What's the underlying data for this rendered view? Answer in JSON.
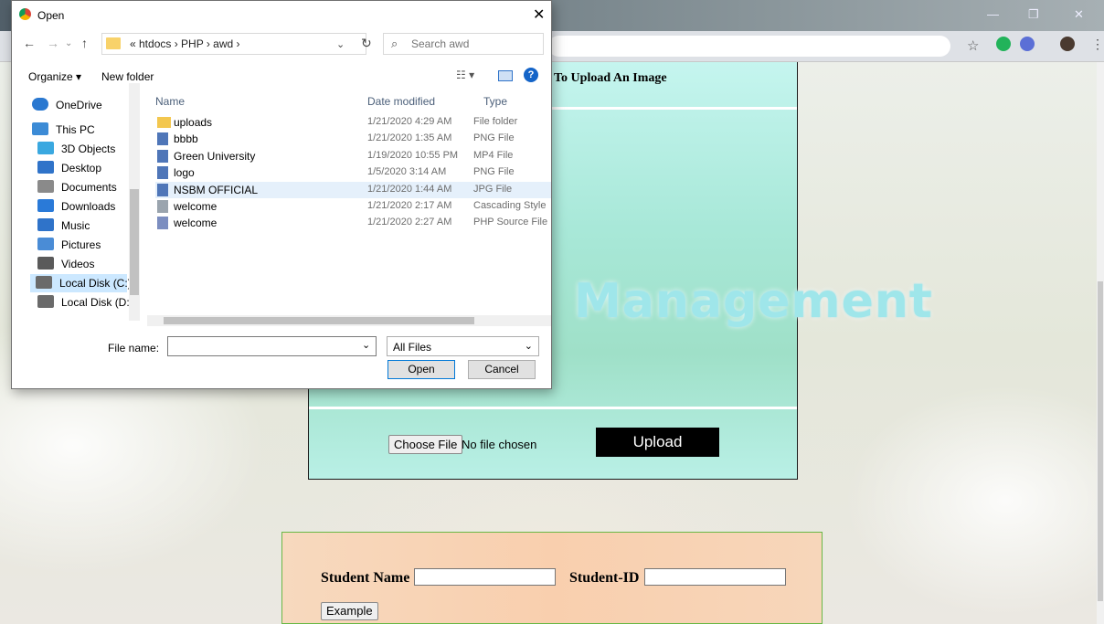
{
  "dialog": {
    "title": "Open",
    "path": "« htdocs › PHP › awd ›",
    "search_placeholder": "Search awd",
    "toolbar": {
      "organize": "Organize ▾",
      "new_folder": "New folder"
    },
    "sidebar": [
      {
        "label": "OneDrive",
        "icon": "cloud-icon",
        "color": "#2a78d0"
      },
      {
        "label": "This PC",
        "icon": "computer-icon",
        "color": "#3c8bd6"
      },
      {
        "label": "3D Objects",
        "icon": "cube-icon",
        "color": "#3aa8e0"
      },
      {
        "label": "Desktop",
        "icon": "desktop-icon",
        "color": "#2f73c9"
      },
      {
        "label": "Documents",
        "icon": "document-icon",
        "color": "#8a8a8a"
      },
      {
        "label": "Downloads",
        "icon": "download-icon",
        "color": "#2a7ad8"
      },
      {
        "label": "Music",
        "icon": "music-icon",
        "color": "#2f73c9"
      },
      {
        "label": "Pictures",
        "icon": "picture-icon",
        "color": "#4a8cd6"
      },
      {
        "label": "Videos",
        "icon": "video-icon",
        "color": "#5a5a5a"
      },
      {
        "label": "Local Disk (C:)",
        "icon": "drive-icon",
        "color": "#6a6a6a"
      },
      {
        "label": "Local Disk (D:)",
        "icon": "drive-icon",
        "color": "#6a6a6a"
      }
    ],
    "columns": {
      "name": "Name",
      "date": "Date modified",
      "type": "Type"
    },
    "files": [
      {
        "name": "uploads",
        "date": "1/21/2020 4:29 AM",
        "type": "File folder",
        "icon": "folder-icon"
      },
      {
        "name": "bbbb",
        "date": "1/21/2020 1:35 AM",
        "type": "PNG File",
        "icon": "image-file-icon"
      },
      {
        "name": "Green University",
        "date": "1/19/2020 10:55 PM",
        "type": "MP4 File",
        "icon": "video-file-icon"
      },
      {
        "name": "logo",
        "date": "1/5/2020 3:14 AM",
        "type": "PNG File",
        "icon": "image-file-icon"
      },
      {
        "name": "NSBM OFFICIAL",
        "date": "1/21/2020 1:44 AM",
        "type": "JPG File",
        "icon": "image-file-icon",
        "selected": true
      },
      {
        "name": "welcome",
        "date": "1/21/2020 2:17 AM",
        "type": "Cascading Style",
        "icon": "css-file-icon"
      },
      {
        "name": "welcome",
        "date": "1/21/2020 2:27 AM",
        "type": "PHP Source File",
        "icon": "php-file-icon"
      }
    ],
    "file_name_label": "File name:",
    "file_name_value": "",
    "filter": "All Files",
    "open_label": "Open",
    "cancel_label": "Cancel"
  },
  "page": {
    "panel_title": "To Upload An Image",
    "banner_text": "Management",
    "choose_file_label": "Choose File",
    "file_status": "No file chosen",
    "upload_label": "Upload",
    "form": {
      "student_name_label": "Student Name",
      "student_id_label": "Student-ID",
      "example_label": "Example"
    }
  },
  "colors": {
    "accent": "#0078d7",
    "panel": "#a8e8d8",
    "form": "#f9cfae",
    "form_border": "#69b845"
  }
}
